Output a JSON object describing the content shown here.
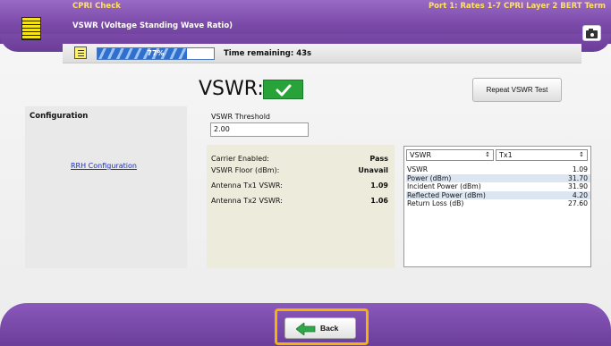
{
  "header": {
    "app_title": "CPRI Check",
    "port_title": "Port 1: Rates 1-7 CPRI Layer 2 BERT Term",
    "sub_title": "VSWR (Voltage Standing Wave Ratio)"
  },
  "progress": {
    "percent_text": "77%",
    "fraction": 0.77,
    "time_remaining": "Time remaining: 43s"
  },
  "vswr": {
    "heading": "VSWR:",
    "status": "pass",
    "status_color": "#27a33a",
    "repeat_button": "Repeat VSWR Test"
  },
  "config": {
    "title": "Configuration",
    "rrh_link": "RRH Configuration"
  },
  "threshold": {
    "label": "VSWR Threshold",
    "value": "2.00"
  },
  "results": [
    {
      "label": "Carrier Enabled:",
      "value": "Pass"
    },
    {
      "label": "VSWR Floor (dBm):",
      "value": "Unavail"
    },
    {
      "label": "Antenna Tx1 VSWR:",
      "value": "1.09"
    },
    {
      "label": "Antenna Tx2 VSWR:",
      "value": "1.06"
    }
  ],
  "table": {
    "select_a": "VSWR",
    "select_b": "Tx1",
    "rows": [
      {
        "label": "VSWR",
        "value": "1.09"
      },
      {
        "label": "Power (dBm)",
        "value": "31.70"
      },
      {
        "label": "Incident Power (dBm)",
        "value": "31.90"
      },
      {
        "label": "Reflected Power (dBm)",
        "value": "4.20"
      },
      {
        "label": "Return Loss (dB)",
        "value": "27.60"
      }
    ]
  },
  "footer": {
    "back_label": "Back",
    "highlight_color": "#f4b400"
  },
  "icons": {
    "app": "app-list-icon",
    "camera": "camera-icon",
    "list": "list-icon",
    "check": "check-icon",
    "back": "back-arrow-icon"
  }
}
